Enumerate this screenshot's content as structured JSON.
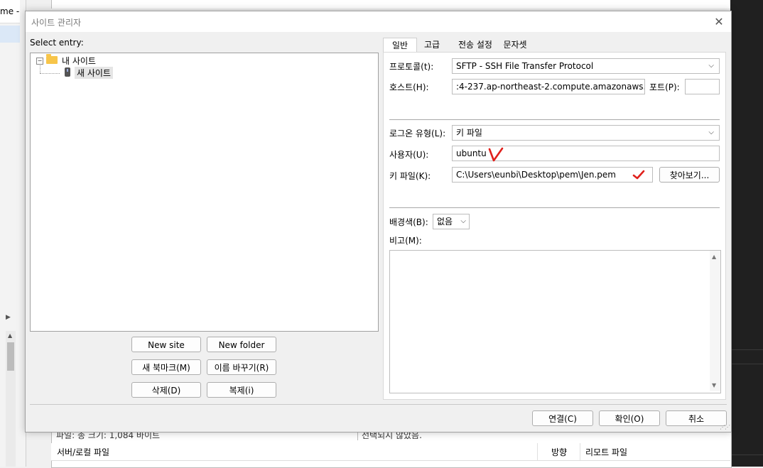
{
  "background": {
    "left_pane_label": "me -",
    "bottom_partial_left": "파일: 총 크기: 1,084 바이트",
    "bottom_partial_right": "선택되지 않았음.",
    "queue_headers": [
      "서버/로컬 파일",
      "방향",
      "리모트 파일"
    ]
  },
  "dialog": {
    "title": "사이트 관리자",
    "close_glyph": "✕",
    "select_entry_label": "Select entry:",
    "tree": {
      "expander_glyph": "−",
      "folder_label": "내 사이트",
      "site_label": "새 사이트"
    },
    "left_buttons": {
      "new_site": "New site",
      "new_folder": "New folder",
      "new_bookmark": "새 북마크(M)",
      "rename": "이름 바꾸기(R)",
      "delete": "삭제(D)",
      "duplicate": "복제(i)"
    },
    "tabs": [
      "일반",
      "고급",
      "전송 설정",
      "문자셋"
    ],
    "general": {
      "protocol_label": "프로토콜(t):",
      "protocol_value": "SFTP - SSH File Transfer Protocol",
      "host_label": "호스트(H):",
      "host_value": ":4-237.ap-northeast-2.compute.amazonaws.com",
      "port_label": "포트(P):",
      "port_value": "",
      "logon_type_label": "로그온 유형(L):",
      "logon_type_value": "키 파일",
      "user_label": "사용자(U):",
      "user_value": "ubuntu",
      "keyfile_label": "키 파일(K):",
      "keyfile_value": "C:\\Users\\eunbi\\Desktop\\pem\\Jen.pem",
      "browse_button": "찾아보기...",
      "bg_color_label": "배경색(B):",
      "bg_color_value": "없음",
      "comments_label": "비고(M):",
      "comments_value": ""
    },
    "footer": {
      "connect": "연결(C)",
      "ok": "확인(O)",
      "cancel": "취소"
    },
    "annotation_color": "#e0201c",
    "caret_glyph": "⌵"
  }
}
